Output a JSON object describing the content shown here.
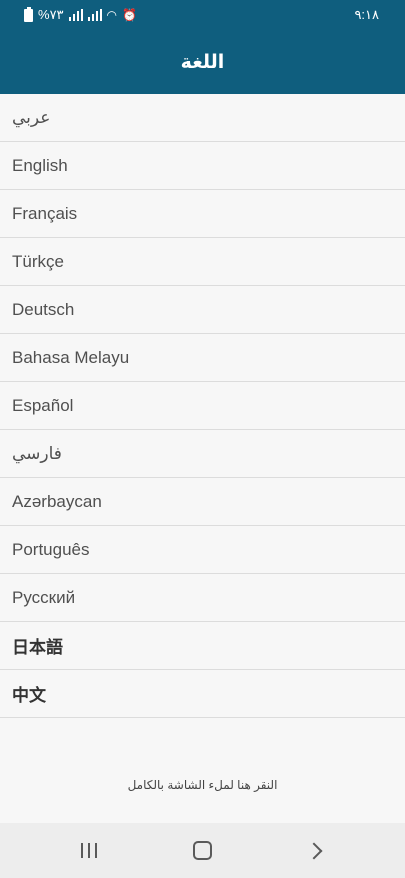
{
  "status_bar": {
    "battery_text": "%٧٣",
    "time": "٩:١٨",
    "icons": [
      "battery-icon",
      "signal-icon",
      "signal-icon",
      "wifi-icon",
      "alarm-icon"
    ]
  },
  "header": {
    "title": "اللغة"
  },
  "languages": [
    {
      "label": "عربي"
    },
    {
      "label": "English"
    },
    {
      "label": "Français"
    },
    {
      "label": "Türkçe"
    },
    {
      "label": "Deutsch"
    },
    {
      "label": "Bahasa Melayu"
    },
    {
      "label": "Español"
    },
    {
      "label": "فارسي"
    },
    {
      "label": "Azərbaycan"
    },
    {
      "label": "Português"
    },
    {
      "label": "Русский"
    },
    {
      "label": "日本語"
    },
    {
      "label": "中文"
    }
  ],
  "footer": {
    "fullscreen_hint": "النقر هنا لملء الشاشة بالكامل"
  },
  "nav_bar": {
    "icons": [
      "recents-icon",
      "home-icon",
      "back-icon"
    ]
  },
  "colors": {
    "header_bg": "#0f5e7e",
    "list_bg": "#f7f7f7",
    "divider": "#dcdcdc",
    "nav_bg": "#ededed"
  }
}
